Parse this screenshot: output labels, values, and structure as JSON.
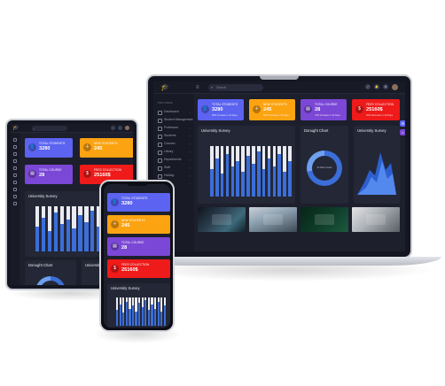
{
  "laptop": {
    "search_placeholder": "Search",
    "sidebar_caption": "MAIN MENU",
    "sidebar_items": [
      "Dashboard",
      "Student Management",
      "Professors",
      "Students",
      "Courses",
      "Library",
      "Departments",
      "Staff",
      "Holiday",
      "Fees"
    ],
    "stats": [
      {
        "label": "TOTAL STUDENTS",
        "value": "3280",
        "sub": "80% Increase in 20 Days",
        "color": "#5b63f0",
        "icon": "user-icon"
      },
      {
        "label": "NEW STUDENTS",
        "value": "245",
        "sub": "50% Increase in 25 Days",
        "color": "#fca311",
        "icon": "user-plus-icon"
      },
      {
        "label": "TOTAL COURSE",
        "value": "28",
        "sub": "76% Increase in 20 Days",
        "color": "#7b47d6",
        "icon": "book-icon"
      },
      {
        "label": "FEES COLLECTION",
        "value": "25160$",
        "sub": "30% Decrease in 30 Days",
        "color": "#ef1a1a",
        "icon": "cash-icon"
      }
    ],
    "survey_title": "University Survey",
    "donut_title": "Donught Chart",
    "donut_caption": "Ac Nam Ceres",
    "area_title": "University Survey"
  },
  "tablet": {
    "stats": [
      {
        "label": "TOTAL STUDENTS",
        "value": "3280"
      },
      {
        "label": "NEW STUDENTS",
        "value": "245"
      },
      {
        "label": "TOTAL COURSE",
        "value": "28"
      },
      {
        "label": "FEES COLLECTION",
        "value": "25160$"
      }
    ],
    "survey_title": "University Survey",
    "donut_title": "Donught Chart",
    "area_title": "University Survey"
  },
  "phone": {
    "stats": [
      {
        "label": "TOTAL STUDENTS",
        "value": "3280"
      },
      {
        "label": "NEW STUDENTS",
        "value": "245"
      },
      {
        "label": "TOTAL COURSE",
        "value": "28"
      },
      {
        "label": "FEES COLLECTION",
        "value": "25160$"
      }
    ],
    "survey_title": "University Survey"
  },
  "colors": {
    "accent": "#5b63f0",
    "orange": "#fca311",
    "purple": "#7b47d6",
    "red": "#ef1a1a",
    "bar": "#3b6ed8",
    "panel": "#242736"
  },
  "survey_bars": {
    "levels": [
      0.55,
      0.75,
      0.45,
      0.85,
      0.6,
      0.7,
      0.5,
      0.8,
      0.65,
      0.9,
      0.55,
      0.75,
      0.6,
      0.85,
      0.5,
      0.7
    ]
  }
}
